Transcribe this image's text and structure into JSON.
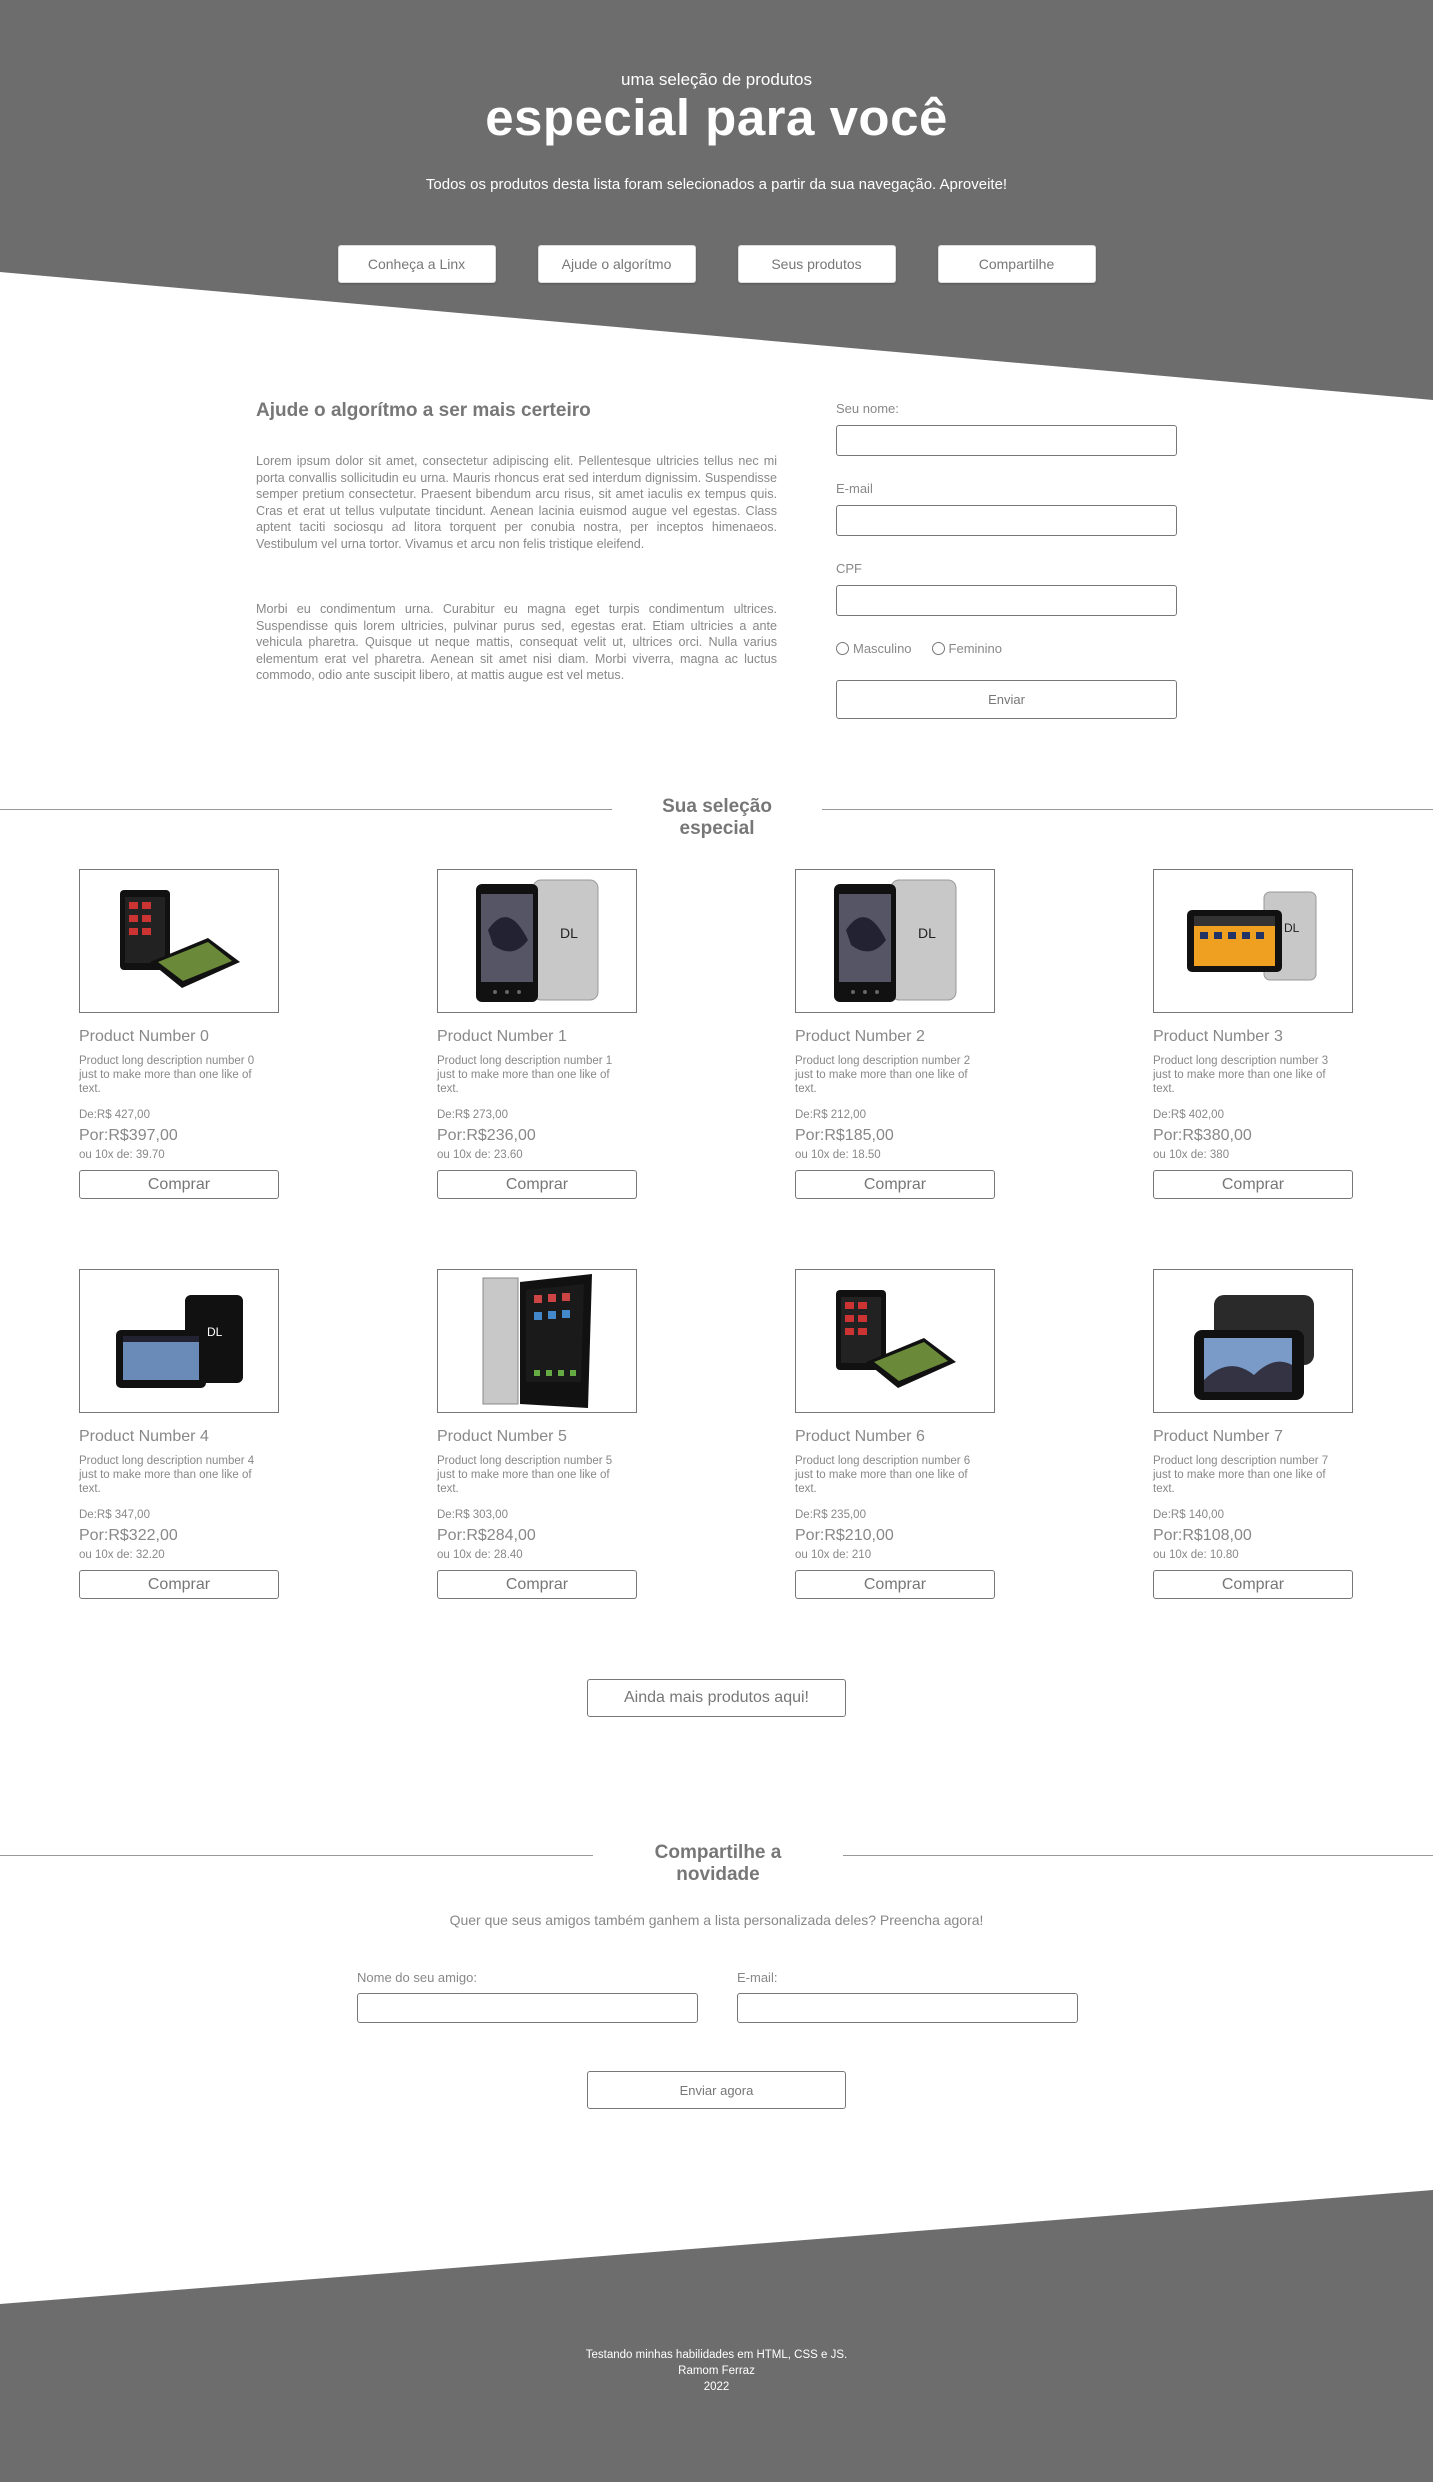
{
  "colors": {
    "header_bg": "#6d6d6d",
    "text": "#777777",
    "border": "#777777",
    "white": "#ffffff"
  },
  "header": {
    "kicker": "uma seleção de produtos",
    "title": "especial para você",
    "subtitle": "Todos os produtos desta lista foram selecionados a partir da sua navegação. Aproveite!",
    "nav": [
      "Conheça a Linx",
      "Ajude o algorítmo",
      "Seus produtos",
      "Compartilhe"
    ]
  },
  "algorithm": {
    "title": "Ajude o algorítmo a ser mais certeiro",
    "paragraph1": "Lorem ipsum dolor sit amet, consectetur adipiscing elit. Pellentesque ultricies tellus nec mi porta convallis sollicitudin eu urna. Mauris rhoncus erat sed interdum dignissim. Suspendisse semper pretium consectetur. Praesent bibendum arcu risus, sit amet iaculis ex tempus quis. Cras et erat ut tellus vulputate tincidunt. Aenean lacinia euismod augue vel egestas. Class aptent taciti sociosqu ad litora torquent per conubia nostra, per inceptos himenaeos. Vestibulum vel urna tortor. Vivamus et arcu non felis tristique eleifend.",
    "paragraph2": "Morbi eu condimentum urna. Curabitur eu magna eget turpis condimentum ultrices. Suspendisse quis lorem ultricies, pulvinar purus sed, egestas erat. Etiam ultricies a ante vehicula pharetra. Quisque ut neque mattis, consequat velit ut, ultrices orci. Nulla varius elementum erat vel pharetra. Aenean sit amet nisi diam. Morbi viverra, magna ac luctus commodo, odio ante suscipit libero, at mattis augue est vel metus.",
    "form": {
      "name_label": "Seu nome:",
      "email_label": "E-mail",
      "cpf_label": "CPF",
      "gender_male": "Masculino",
      "gender_female": "Feminino",
      "submit": "Enviar"
    }
  },
  "selection": {
    "title": "Sua seleção especial",
    "products": [
      {
        "name": "Product Number 0",
        "desc": "Product long description number 0 just to make more than one like of text.",
        "old": "De:R$ 427,00",
        "price": "Por:R$397,00",
        "inst": "ou 10x de: 39.70",
        "buy": "Comprar",
        "image": "tablet-pair-dark-icon"
      },
      {
        "name": "Product Number 1",
        "desc": "Product long description number 1 just to make more than one like of text.",
        "old": "De:R$ 273,00",
        "price": "Por:R$236,00",
        "inst": "ou 10x de: 23.60",
        "buy": "Comprar",
        "image": "tablet-silver-back-icon"
      },
      {
        "name": "Product Number 2",
        "desc": "Product long description number 2 just to make more than one like of text.",
        "old": "De:R$ 212,00",
        "price": "Por:R$185,00",
        "inst": "ou 10x de: 18.50",
        "buy": "Comprar",
        "image": "tablet-silver-back-icon"
      },
      {
        "name": "Product Number 3",
        "desc": "Product long description number 3 just to make more than one like of text.",
        "old": "De:R$ 402,00",
        "price": "Por:R$380,00",
        "inst": "ou 10x de: 380",
        "buy": "Comprar",
        "image": "tablet-landscape-silver-icon"
      },
      {
        "name": "Product Number 4",
        "desc": "Product long description number 4 just to make more than one like of text.",
        "old": "De:R$ 347,00",
        "price": "Por:R$322,00",
        "inst": "ou 10x de: 32.20",
        "buy": "Comprar",
        "image": "tablet-landscape-dark-icon"
      },
      {
        "name": "Product Number 5",
        "desc": "Product long description number 5 just to make more than one like of text.",
        "old": "De:R$ 303,00",
        "price": "Por:R$284,00",
        "inst": "ou 10x de: 28.40",
        "buy": "Comprar",
        "image": "tablet-tall-icon"
      },
      {
        "name": "Product Number 6",
        "desc": "Product long description number 6 just to make more than one like of text.",
        "old": "De:R$ 235,00",
        "price": "Por:R$210,00",
        "inst": "ou 10x de: 210",
        "buy": "Comprar",
        "image": "tablet-pair-dark-icon"
      },
      {
        "name": "Product Number 7",
        "desc": "Product long description number 7 just to make more than one like of text.",
        "old": "De:R$ 140,00",
        "price": "Por:R$108,00",
        "inst": "ou 10x de: 10.80",
        "buy": "Comprar",
        "image": "tablet-black-back-icon"
      }
    ],
    "more": "Ainda mais produtos aqui!"
  },
  "share": {
    "title": "Compartilhe a novidade",
    "subtitle": "Quer que seus amigos também ganhem a lista personalizada deles? Preencha agora!",
    "friend_name_label": "Nome do seu amigo:",
    "email_label": "E-mail:",
    "submit": "Enviar agora"
  },
  "footer": {
    "line1": "Testando minhas habilidades em HTML, CSS e JS.",
    "line2": "Ramom Ferraz",
    "line3": "2022"
  }
}
